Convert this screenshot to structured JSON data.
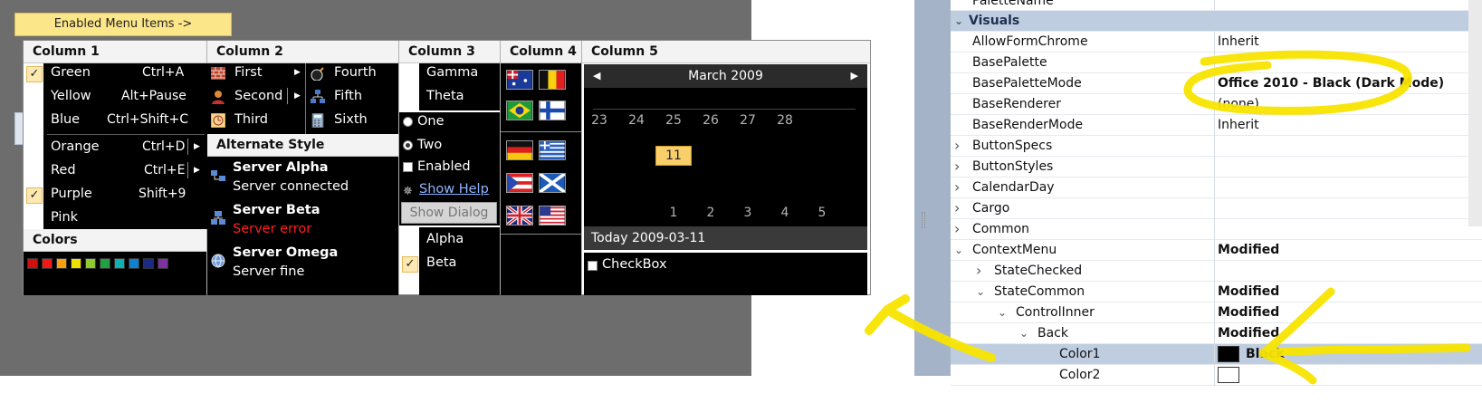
{
  "designer": {
    "enabled_button": "Enabled Menu Items ->"
  },
  "menu": {
    "col1": {
      "header": "Column 1",
      "items": [
        {
          "label": "Green",
          "shortcut": "Ctrl+A",
          "checked": true
        },
        {
          "label": "Yellow",
          "shortcut": "Alt+Pause",
          "checked": false
        },
        {
          "label": "Blue",
          "shortcut": "Ctrl+Shift+C",
          "checked": false
        },
        {
          "label": "Orange",
          "shortcut": "Ctrl+D",
          "checked": false
        },
        {
          "label": "Red",
          "shortcut": "Ctrl+E",
          "checked": false
        },
        {
          "label": "Purple",
          "shortcut": "Shift+9",
          "checked": true
        },
        {
          "label": "Pink",
          "shortcut": "",
          "checked": false
        }
      ],
      "colors_header": "Colors",
      "swatches": [
        "#d01010",
        "#f01818",
        "#f8a010",
        "#f0e000",
        "#90c830",
        "#20a040",
        "#10b0b0",
        "#1080d0",
        "#1a2a80",
        "#8030a0"
      ]
    },
    "col2": {
      "header": "Column 2",
      "items": [
        "First",
        "Second",
        "Third"
      ],
      "items_right": [
        "Fourth",
        "Fifth",
        "Sixth"
      ],
      "alt_header": "Alternate Style",
      "servers": [
        {
          "name": "Server Alpha",
          "status": "Server connected",
          "status_color": "#ffffff"
        },
        {
          "name": "Server Beta",
          "status": "Server error",
          "status_color": "#ff2020"
        },
        {
          "name": "Server Omega",
          "status": "Server fine",
          "status_color": "#ffffff"
        }
      ]
    },
    "col3": {
      "header": "Column 3",
      "top_items": [
        "Gamma",
        "Theta"
      ],
      "radio_one": "One",
      "radio_two": "Two",
      "enabled": "Enabled",
      "show_help": "Show Help",
      "show_dialog": "Show Dialog",
      "bottom_items": [
        "Alpha",
        "Beta"
      ]
    },
    "col4": {
      "header": "Column 4"
    },
    "col5": {
      "header": "Column 5",
      "month": "March 2009",
      "row1": [
        "23",
        "24",
        "25",
        "26",
        "27",
        "28"
      ],
      "today": "11",
      "row_last": [
        "1",
        "2",
        "3",
        "4",
        "5"
      ],
      "today_label": "Today 2009-03-11",
      "checkbox": "CheckBox"
    }
  },
  "props": {
    "rows": [
      {
        "name": "PaletteName",
        "value": "",
        "indent": 0,
        "type": "plain",
        "clip": true
      },
      {
        "name": "Visuals",
        "value": "",
        "indent": 0,
        "type": "cat",
        "exp": "v"
      },
      {
        "name": "AllowFormChrome",
        "value": "Inherit",
        "indent": 0,
        "type": "plain"
      },
      {
        "name": "BasePalette",
        "value": "",
        "indent": 0,
        "type": "plain"
      },
      {
        "name": "BasePaletteMode",
        "value": "Office 2010 - Black (Dark Mode)",
        "indent": 0,
        "type": "bold"
      },
      {
        "name": "BaseRenderer",
        "value": "(none)",
        "indent": 0,
        "type": "plain"
      },
      {
        "name": "BaseRenderMode",
        "value": "Inherit",
        "indent": 0,
        "type": "plain"
      },
      {
        "name": "ButtonSpecs",
        "value": "",
        "indent": 0,
        "type": "plain",
        "exp": ">"
      },
      {
        "name": "ButtonStyles",
        "value": "",
        "indent": 0,
        "type": "plain",
        "exp": ">"
      },
      {
        "name": "CalendarDay",
        "value": "",
        "indent": 0,
        "type": "plain",
        "exp": ">"
      },
      {
        "name": "Cargo",
        "value": "",
        "indent": 0,
        "type": "plain",
        "exp": ">"
      },
      {
        "name": "Common",
        "value": "",
        "indent": 0,
        "type": "plain",
        "exp": ">"
      },
      {
        "name": "ContextMenu",
        "value": "Modified",
        "indent": 0,
        "type": "bold",
        "exp": "v"
      },
      {
        "name": "StateChecked",
        "value": "",
        "indent": 1,
        "type": "plain",
        "exp": ">"
      },
      {
        "name": "StateCommon",
        "value": "Modified",
        "indent": 1,
        "type": "bold",
        "exp": "v"
      },
      {
        "name": "ControlInner",
        "value": "Modified",
        "indent": 2,
        "type": "bold",
        "exp": "v"
      },
      {
        "name": "Back",
        "value": "Modified",
        "indent": 3,
        "type": "bold",
        "exp": "v"
      },
      {
        "name": "Color1",
        "value": "Black",
        "indent": 4,
        "type": "color",
        "swatch": "#000000",
        "selected": true
      },
      {
        "name": "Color2",
        "value": "",
        "indent": 4,
        "type": "color",
        "swatch": "#ffffff"
      }
    ]
  }
}
